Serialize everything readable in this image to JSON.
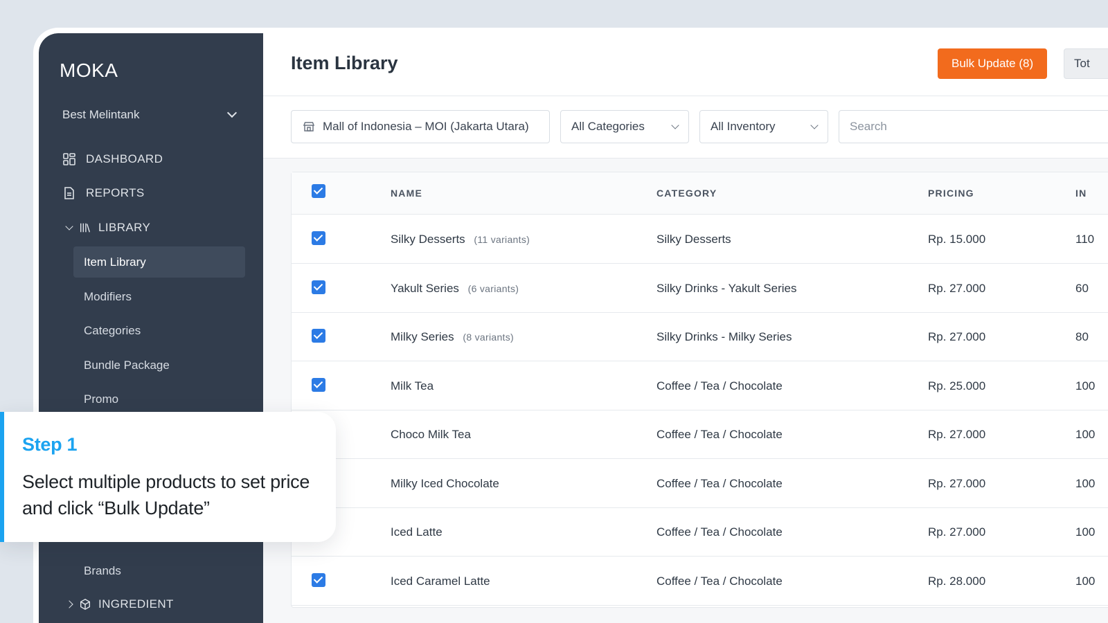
{
  "sidebar": {
    "brand": "MOKA",
    "outlet": "Best Melintank",
    "nav": {
      "dashboard": "DASHBOARD",
      "reports": "REPORTS",
      "library": "LIBRARY",
      "ingredient": "INGREDIENT"
    },
    "library_items": [
      "Item Library",
      "Modifiers",
      "Categories",
      "Bundle Package",
      "Promo",
      "Brands"
    ]
  },
  "header": {
    "title": "Item Library",
    "bulk_update_label": "Bulk Update (8)",
    "tot_label": "Tot"
  },
  "filters": {
    "outlet": "Mall of Indonesia – MOI (Jakarta Utara)",
    "category": "All Categories",
    "inventory": "All Inventory",
    "search_placeholder": "Search"
  },
  "table": {
    "columns": [
      "NAME",
      "CATEGORY",
      "PRICING",
      "IN"
    ],
    "rows": [
      {
        "name": "Silky Desserts",
        "variants": "(11 variants)",
        "category": "Silky Desserts",
        "pricing": "Rp. 15.000",
        "inventory": "110",
        "checked": true
      },
      {
        "name": "Yakult Series",
        "variants": "(6 variants)",
        "category": "Silky Drinks - Yakult Series",
        "pricing": "Rp. 27.000",
        "inventory": "60",
        "checked": true
      },
      {
        "name": "Milky Series",
        "variants": "(8 variants)",
        "category": "Silky Drinks - Milky Series",
        "pricing": "Rp. 27.000",
        "inventory": "80",
        "checked": true
      },
      {
        "name": "Milk Tea",
        "variants": "",
        "category": "Coffee / Tea / Chocolate",
        "pricing": "Rp. 25.000",
        "inventory": "100",
        "checked": true
      },
      {
        "name": "Choco Milk Tea",
        "variants": "",
        "category": "Coffee / Tea / Chocolate",
        "pricing": "Rp. 27.000",
        "inventory": "100",
        "checked": true
      },
      {
        "name": "Milky Iced Chocolate",
        "variants": "",
        "category": "Coffee / Tea / Chocolate",
        "pricing": "Rp. 27.000",
        "inventory": "100",
        "checked": true
      },
      {
        "name": "Iced Latte",
        "variants": "",
        "category": "Coffee / Tea / Chocolate",
        "pricing": "Rp. 27.000",
        "inventory": "100",
        "checked": true
      },
      {
        "name": "Iced Caramel Latte",
        "variants": "",
        "category": "Coffee / Tea / Chocolate",
        "pricing": "Rp. 28.000",
        "inventory": "100",
        "checked": true
      }
    ]
  },
  "callout": {
    "step": "Step 1",
    "text": "Select multiple products to set price and click “Bulk Update”"
  },
  "colors": {
    "sidebar_bg": "#323d4d",
    "accent_orange": "#f26b1d",
    "checkbox_blue": "#2c7be5",
    "step_blue": "#1ba3f0"
  }
}
